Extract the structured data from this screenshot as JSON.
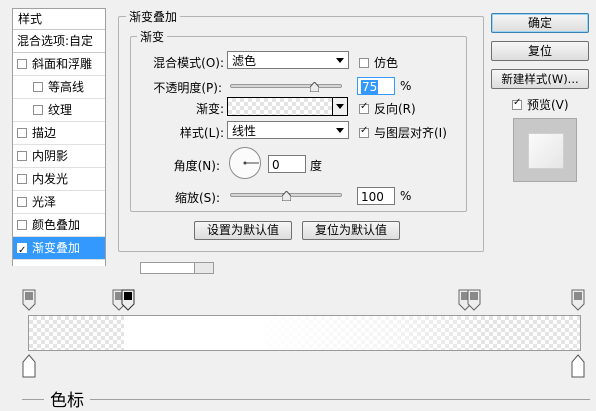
{
  "left_panel": {
    "title": "样式",
    "blend_options": "混合选项:自定",
    "items": [
      {
        "label": "斜面和浮雕",
        "checked": false,
        "sub": false,
        "selected": false
      },
      {
        "label": "等高线",
        "checked": false,
        "sub": true,
        "selected": false
      },
      {
        "label": "纹理",
        "checked": false,
        "sub": true,
        "selected": false
      },
      {
        "label": "描边",
        "checked": false,
        "sub": false,
        "selected": false
      },
      {
        "label": "内阴影",
        "checked": false,
        "sub": false,
        "selected": false
      },
      {
        "label": "内发光",
        "checked": false,
        "sub": false,
        "selected": false
      },
      {
        "label": "光泽",
        "checked": false,
        "sub": false,
        "selected": false
      },
      {
        "label": "颜色叠加",
        "checked": false,
        "sub": false,
        "selected": false
      },
      {
        "label": "渐变叠加",
        "checked": true,
        "sub": false,
        "selected": true
      }
    ]
  },
  "gradient_overlay": {
    "group_title": "渐变叠加",
    "subgroup_title": "渐变",
    "blend_mode_label": "混合模式(O):",
    "blend_mode_value": "滤色",
    "dither_label": "仿色",
    "dither_checked": false,
    "opacity_label": "不透明度(P):",
    "opacity_value": "75",
    "opacity_unit": "%",
    "opacity_level": 0.75,
    "gradient_label": "渐变:",
    "reverse_label": "反向(R)",
    "reverse_checked": true,
    "style_label": "样式(L):",
    "style_value": "线性",
    "align_label": "与图层对齐(I)",
    "align_checked": true,
    "angle_label": "角度(N):",
    "angle_value": "0",
    "angle_unit": "度",
    "scale_label": "缩放(S):",
    "scale_value": "100",
    "scale_unit": "%",
    "scale_level": 0.5,
    "make_default": "设置为默认值",
    "reset_default": "复位为默认值"
  },
  "right_panel": {
    "ok": "确定",
    "reset": "复位",
    "new_style": "新建样式(W)...",
    "preview_label": "预览(V)",
    "preview_checked": true
  },
  "gradient_editor": {
    "section_title": "色标"
  },
  "icons": {
    "stop": "color-stop-icon",
    "angle": "angle-dial-icon",
    "dropdown": "chevron-down-icon"
  }
}
